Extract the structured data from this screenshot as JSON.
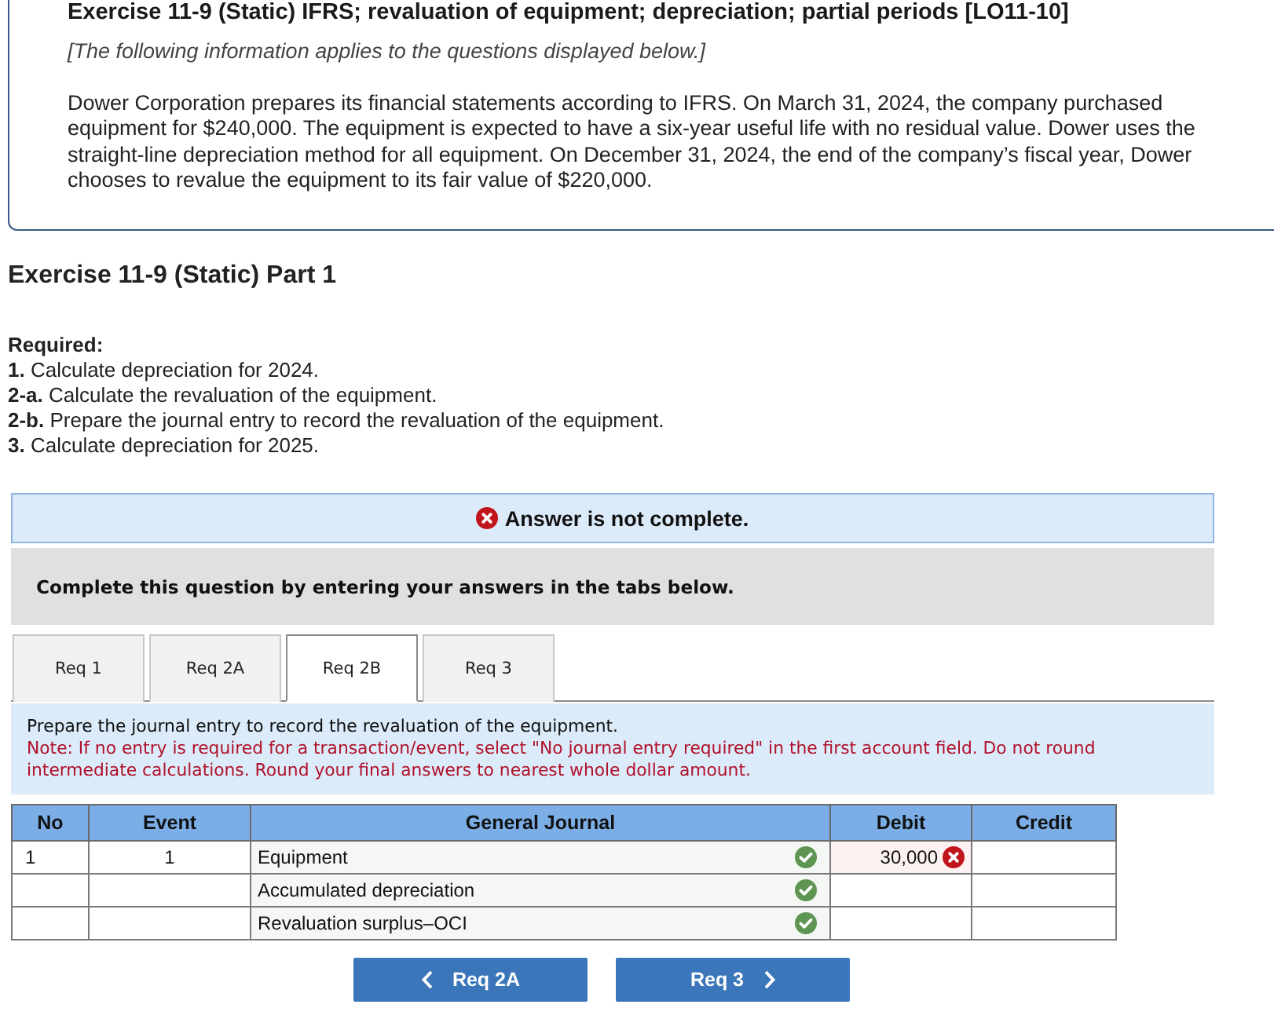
{
  "header": {
    "title": "Exercise 11-9 (Static) IFRS; revaluation of equipment; depreciation; partial periods [LO11-10]",
    "intro": "[The following information applies to the questions displayed below.]",
    "body": "Dower Corporation prepares its financial statements according to IFRS. On March 31, 2024, the company purchased equipment for $240,000. The equipment is expected to have a six-year useful life with no residual value. Dower uses the straight-line depreciation method for all equipment. On December 31, 2024, the end of the company’s fiscal year, Dower chooses to revalue the equipment to its fair value of $220,000."
  },
  "part": {
    "title": "Exercise 11-9 (Static) Part 1",
    "required_label": "Required:",
    "requirements": [
      "**1.** Calculate depreciation for 2024.",
      "**2-a.** Calculate the revaluation of the equipment.",
      "**2-b.** Prepare the journal entry to record the revaluation of the equipment.",
      "**3.** Calculate depreciation for 2025."
    ]
  },
  "status_banner": {
    "kind": "incomplete",
    "text": "Answer is not complete."
  },
  "instruction_bar": {
    "text": "Complete this question by entering your answers in the tabs below."
  },
  "tabs": [
    {
      "label": "Req 1",
      "selected": false
    },
    {
      "label": "Req 2A",
      "selected": false
    },
    {
      "label": "Req 2B",
      "selected": true
    },
    {
      "label": "Req 3",
      "selected": false
    }
  ],
  "panel": {
    "prompt": "Prepare the journal entry to record the revaluation of the equipment.",
    "note": "Note: If no entry is required for a transaction/event, select \"No journal entry required\" in the first account field. Do not round intermediate calculations. Round your final answers to nearest whole dollar amount."
  },
  "journal": {
    "columns": [
      "No",
      "Event",
      "General Journal",
      "Debit",
      "Credit"
    ],
    "rows": [
      {
        "no": "1",
        "event": "1",
        "account": "Equipment",
        "account_correct": true,
        "debit": "30,000",
        "debit_correct": false
      },
      {
        "account": "Accumulated depreciation",
        "account_correct": true
      },
      {
        "account": "Revaluation surplus–OCI",
        "account_correct": true
      }
    ]
  },
  "nav_buttons": [
    {
      "label": "Req 2A",
      "kind": "previous"
    },
    {
      "label": "Req 3",
      "kind": "next"
    }
  ]
}
